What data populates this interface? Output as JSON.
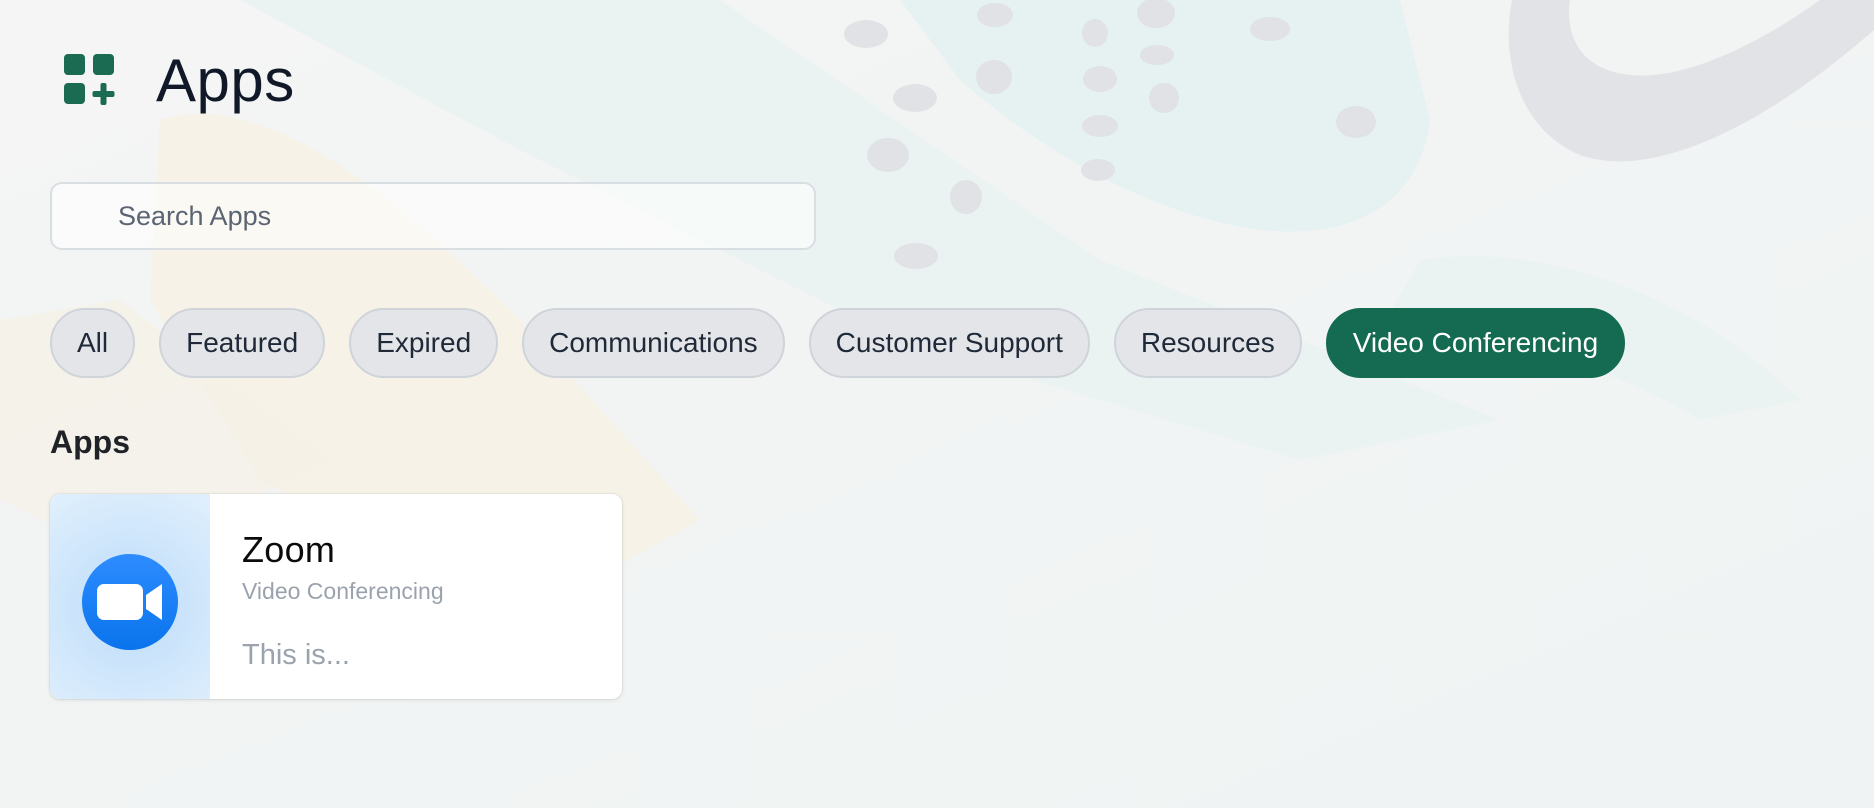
{
  "header": {
    "title": "Apps",
    "logo_icon": "apps-grid-plus-icon",
    "brand_color": "#1a6b52"
  },
  "search": {
    "placeholder": "Search Apps",
    "value": ""
  },
  "filters": {
    "active_color": "#156b52",
    "items": [
      {
        "label": "All",
        "active": false
      },
      {
        "label": "Featured",
        "active": false
      },
      {
        "label": "Expired",
        "active": false
      },
      {
        "label": "Communications",
        "active": false
      },
      {
        "label": "Customer Support",
        "active": false
      },
      {
        "label": "Resources",
        "active": false
      },
      {
        "label": "Video Conferencing",
        "active": true
      }
    ]
  },
  "section": {
    "title": "Apps"
  },
  "apps": [
    {
      "name": "Zoom",
      "category": "Video Conferencing",
      "description": "This is...",
      "icon": "zoom-video-camera-icon",
      "icon_color": "#0b82f4"
    }
  ]
}
